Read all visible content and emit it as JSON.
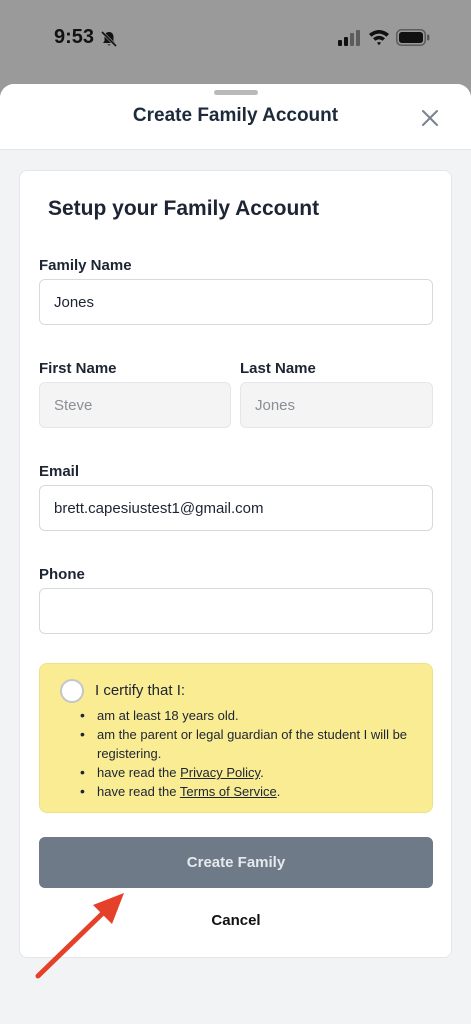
{
  "status_bar": {
    "time": "9:53"
  },
  "sheet": {
    "title": "Create Family Account"
  },
  "form": {
    "heading": "Setup your Family Account",
    "family_name": {
      "label": "Family Name",
      "value": "Jones"
    },
    "first_name": {
      "label": "First Name",
      "value": "Steve"
    },
    "last_name": {
      "label": "Last Name",
      "value": "Jones"
    },
    "email": {
      "label": "Email",
      "value": "brett.capesiustest1@gmail.com"
    },
    "phone": {
      "label": "Phone",
      "value": ""
    }
  },
  "certify": {
    "title": "I certify that I:",
    "items": {
      "age": "am at least 18 years old.",
      "guardian": "am the parent or legal guardian of the student I will be registering.",
      "privacy_prefix": "have read the ",
      "privacy_link": "Privacy Policy",
      "terms_prefix": "have read the ",
      "terms_link": "Terms of Service",
      "end": "."
    }
  },
  "actions": {
    "create_label": "Create Family",
    "cancel_label": "Cancel"
  },
  "colors": {
    "accent_yellow": "#f9ec93",
    "button_gray": "#6e7a88",
    "annotation_arrow": "#e5402a"
  }
}
